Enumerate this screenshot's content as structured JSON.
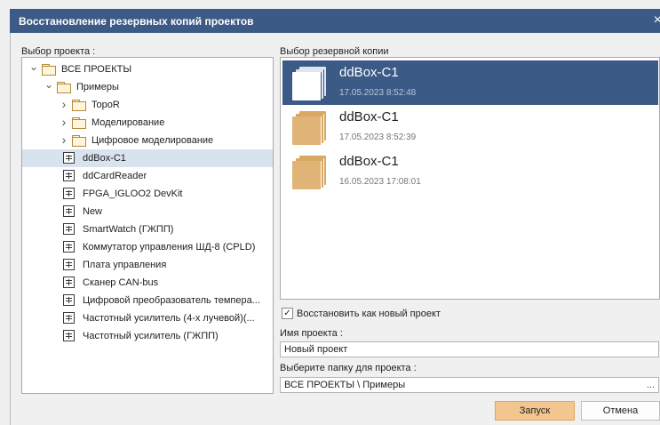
{
  "window": {
    "title": "Восстановление резервных копий проектов",
    "close_glyph": "×"
  },
  "project_select": {
    "label": "Выбор проекта :",
    "tree": [
      {
        "label": "ВСЕ ПРОЕКТЫ",
        "type": "folder",
        "level": 0,
        "expander": "v"
      },
      {
        "label": "Примеры",
        "type": "folder",
        "level": 1,
        "expander": "v"
      },
      {
        "label": "TopoR",
        "type": "folder",
        "level": 2,
        "expander": ">"
      },
      {
        "label": "Моделирование",
        "type": "folder",
        "level": 2,
        "expander": ">"
      },
      {
        "label": "Цифровое моделирование",
        "type": "folder",
        "level": 2,
        "expander": ">"
      },
      {
        "label": "ddBox-C1",
        "type": "project",
        "level": 2,
        "selected": true
      },
      {
        "label": "ddCardReader",
        "type": "project",
        "level": 2
      },
      {
        "label": "FPGA_IGLOO2 DevKit",
        "type": "project",
        "level": 2
      },
      {
        "label": "New",
        "type": "project",
        "level": 2
      },
      {
        "label": "SmartWatch (ГЖПП)",
        "type": "project",
        "level": 2
      },
      {
        "label": "Коммутатор управления ШД-8 (CPLD)",
        "type": "project",
        "level": 2
      },
      {
        "label": "Плата управления",
        "type": "project",
        "level": 2
      },
      {
        "label": "Сканер CAN-bus",
        "type": "project",
        "level": 2
      },
      {
        "label": "Цифровой преобразователь темпера...",
        "type": "project",
        "level": 2
      },
      {
        "label": "Частотный усилитель (4-х лучевой)(...",
        "type": "project",
        "level": 2
      },
      {
        "label": "Частотный усилитель (ГЖПП)",
        "type": "project",
        "level": 2
      }
    ]
  },
  "backup_select": {
    "label": "Выбор резервной копии",
    "items": [
      {
        "name": "ddBox-C1",
        "date": "17.05.2023 8:52:48",
        "selected": true
      },
      {
        "name": "ddBox-C1",
        "date": "17.05.2023 8:52:39",
        "selected": false
      },
      {
        "name": "ddBox-C1",
        "date": "16.05.2023 17:08:01",
        "selected": false
      }
    ]
  },
  "restore_as_new": {
    "label": "Восстановить как новый проект",
    "checked": true,
    "check_glyph": "✓"
  },
  "project_name": {
    "label": "Имя проекта :",
    "value": "Новый проект"
  },
  "project_folder": {
    "label": "Выберите папку для проекта :",
    "value": "ВСЕ ПРОЕКТЫ \\ Примеры",
    "browse_label": "..."
  },
  "buttons": {
    "run": "Запуск",
    "cancel": "Отмена"
  },
  "colors": {
    "titlebar": "#3b5a86",
    "selection": "#3b5a86",
    "tree_selection": "#d9e3ef",
    "accent_button": "#f3c68f",
    "backup_icon": "#e0b477"
  }
}
